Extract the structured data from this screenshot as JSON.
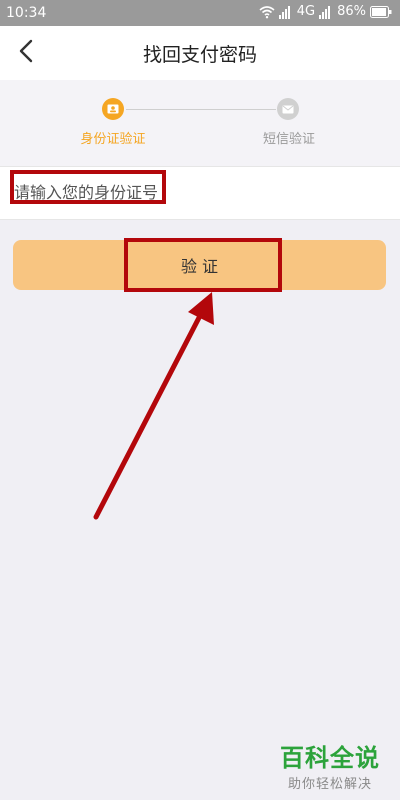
{
  "status_bar": {
    "time": "10:34",
    "network": "4G",
    "battery": "86%",
    "icons": [
      "wifi-icon",
      "signal-icon",
      "signal-icon",
      "battery-icon"
    ]
  },
  "nav": {
    "title": "找回支付密码",
    "back_icon": "chevron-left-icon"
  },
  "steps": [
    {
      "label": "身份证验证",
      "state": "active",
      "icon": "id-card-icon"
    },
    {
      "label": "短信验证",
      "state": "inactive",
      "icon": "mail-icon"
    }
  ],
  "form": {
    "id_placeholder": "请输入您的身份证号",
    "id_value": ""
  },
  "verify_button": {
    "label": "验 证"
  },
  "watermark": {
    "title": "百科全说",
    "subtitle": "助你轻松解决"
  },
  "colors": {
    "accent": "#f5a623",
    "button": "#f8c581",
    "annotation": "#b3070b",
    "watermark": "#2ca33b",
    "status_bar": "#9a9a9a"
  }
}
